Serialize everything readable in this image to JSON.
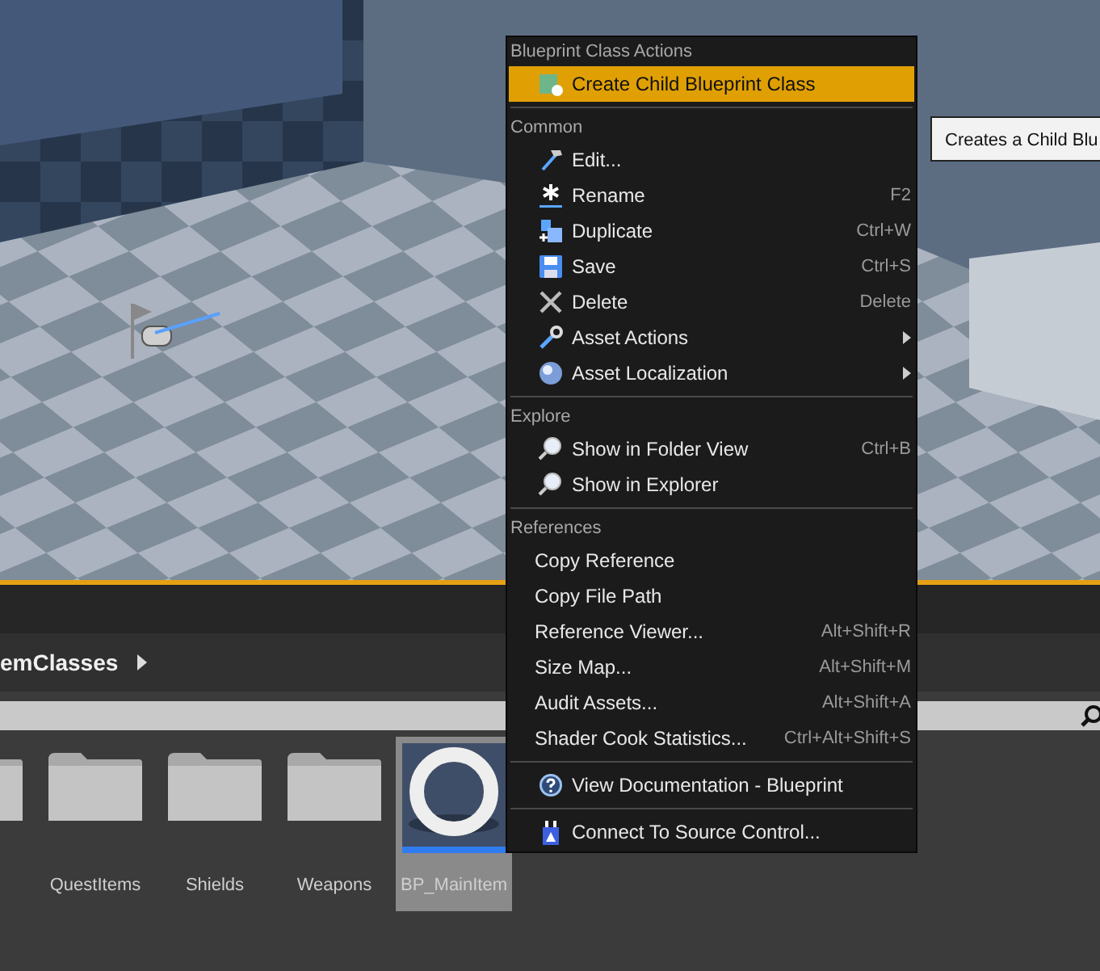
{
  "viewport": {
    "highlighted": true
  },
  "content_browser": {
    "path_segment": "emClasses",
    "items": [
      {
        "kind": "folder",
        "selected": false
      },
      {
        "kind": "folder",
        "label": "QuestItems",
        "selected": false
      },
      {
        "kind": "folder",
        "label": "Shields",
        "selected": false
      },
      {
        "kind": "folder",
        "label": "Weapons",
        "selected": false
      },
      {
        "kind": "blueprint",
        "label": "BP_MainItem",
        "selected": true
      }
    ]
  },
  "context_menu": {
    "sections": [
      {
        "heading": "Blueprint Class Actions",
        "items": [
          {
            "label": "Create Child Blueprint Class",
            "kind": "blueprint",
            "highlighted": true,
            "submenu": false
          }
        ]
      },
      {
        "heading": "Common",
        "items": [
          {
            "label": "Edit...",
            "kind": "hammer",
            "highlighted": false,
            "submenu": false
          },
          {
            "label": "Rename",
            "kind": "star",
            "shortcut": "F2",
            "highlighted": false,
            "submenu": false
          },
          {
            "label": "Duplicate",
            "kind": "duplicate",
            "shortcut": "Ctrl+W",
            "highlighted": false,
            "submenu": false
          },
          {
            "label": "Save",
            "kind": "save",
            "shortcut": "Ctrl+S",
            "highlighted": false,
            "submenu": false
          },
          {
            "label": "Delete",
            "kind": "cross",
            "shortcut": "Delete",
            "highlighted": false,
            "submenu": false
          },
          {
            "label": "Asset Actions",
            "kind": "wrench",
            "highlighted": false,
            "submenu": true
          },
          {
            "label": "Asset Localization",
            "kind": "sphere",
            "highlighted": false,
            "submenu": true
          }
        ]
      },
      {
        "heading": "Explore",
        "items": [
          {
            "label": "Show in Folder View",
            "kind": "magnifier",
            "shortcut": "Ctrl+B",
            "highlighted": false,
            "submenu": false
          },
          {
            "label": "Show in Explorer",
            "kind": "magnifier",
            "highlighted": false,
            "submenu": false
          }
        ]
      },
      {
        "heading": "References",
        "items": [
          {
            "label": "Copy Reference",
            "highlighted": false,
            "submenu": false
          },
          {
            "label": "Copy File Path",
            "highlighted": false,
            "submenu": false
          },
          {
            "label": "Reference Viewer...",
            "shortcut": "Alt+Shift+R",
            "highlighted": false,
            "submenu": false
          },
          {
            "label": "Size Map...",
            "shortcut": "Alt+Shift+M",
            "highlighted": false,
            "submenu": false
          },
          {
            "label": "Audit Assets...",
            "shortcut": "Alt+Shift+A",
            "highlighted": false,
            "submenu": false
          },
          {
            "label": "Shader Cook Statistics...",
            "shortcut": "Ctrl+Alt+Shift+S",
            "highlighted": false,
            "submenu": false
          }
        ]
      },
      {
        "items": [
          {
            "label": "View Documentation - Blueprint",
            "kind": "help",
            "highlighted": false,
            "submenu": false
          }
        ]
      },
      {
        "items": [
          {
            "label": "Connect To Source Control...",
            "kind": "plug",
            "highlighted": false,
            "submenu": false
          }
        ]
      }
    ]
  },
  "tooltip": {
    "text": "Creates a Child Blu"
  }
}
